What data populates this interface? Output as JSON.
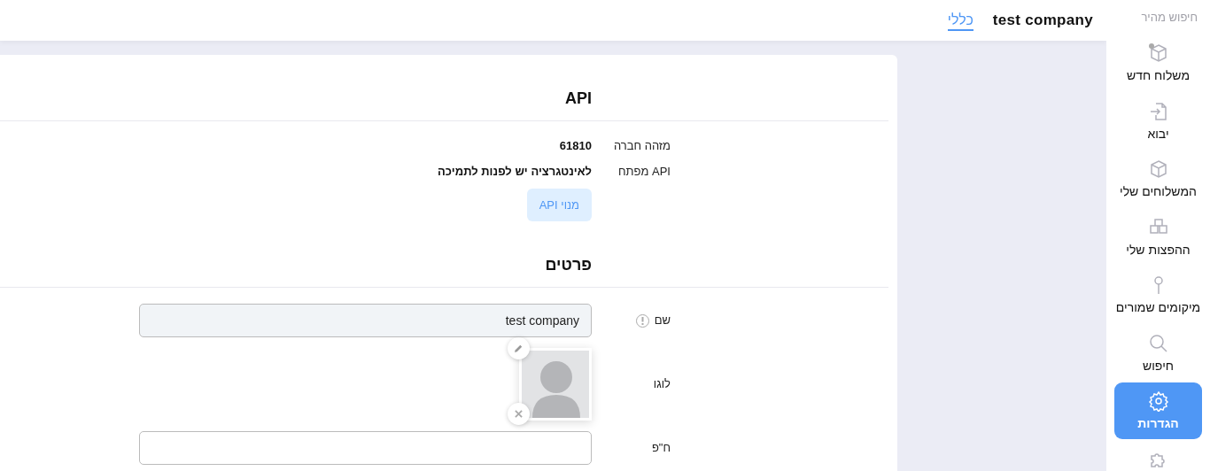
{
  "header": {
    "company": "test company",
    "tabs": [
      {
        "label": "כללי",
        "selected": true
      }
    ]
  },
  "sidebar": {
    "quick_search": "חיפוש מהיר",
    "items": [
      {
        "kind": "new-box",
        "label": "משלוח חדש",
        "selected": false
      },
      {
        "kind": "import",
        "label": "יבוא",
        "selected": false
      },
      {
        "kind": "box",
        "label": "המשלוחים שלי",
        "selected": false
      },
      {
        "kind": "boxes",
        "label": "ההפצות שלי",
        "selected": false
      },
      {
        "kind": "pin",
        "label": "מיקומים שמורים",
        "selected": false
      },
      {
        "kind": "search",
        "label": "חיפוש",
        "selected": false
      },
      {
        "kind": "gear",
        "label": "הגדרות",
        "selected": true
      },
      {
        "kind": "puzzle",
        "selected": false
      }
    ]
  },
  "sections": [
    {
      "title": "API",
      "rows": [
        {
          "kind": "text",
          "label": "מזהה חברה",
          "value": "61810"
        },
        {
          "kind": "text",
          "label": "API מפתח",
          "value": "לאינטגרציה יש לפנות לתמיכה"
        },
        {
          "kind": "button",
          "button": "מנוי API"
        }
      ]
    },
    {
      "title": "פרטים",
      "rows": [
        {
          "kind": "field",
          "label": "שם",
          "info": true,
          "value": "test company",
          "disabled": true
        },
        {
          "kind": "logo",
          "label": "לוגו"
        },
        {
          "kind": "field",
          "label": "ח\"פ",
          "info": false,
          "value": "",
          "disabled": false
        }
      ]
    }
  ]
}
